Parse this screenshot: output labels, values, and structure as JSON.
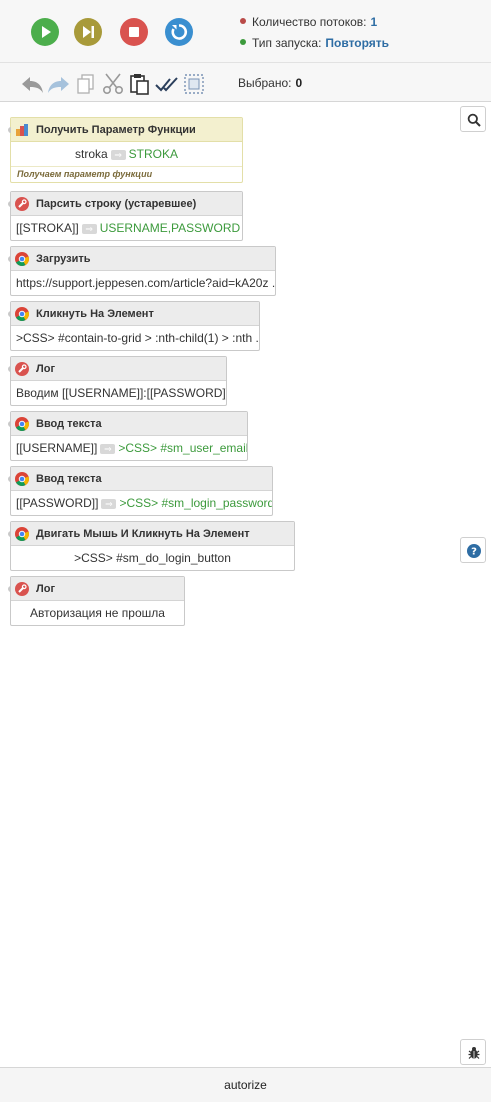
{
  "header": {
    "threads_label": "Количество потоков:",
    "threads_value": "1",
    "launch_label": "Тип запуска:",
    "launch_value": "Повторять",
    "selected_label": "Выбрано:",
    "selected_value": "0",
    "colors": {
      "play": "#4cae4c",
      "step": "#a89a3a",
      "stop": "#d9534f",
      "reset": "#3a8fd0",
      "dot_red": "#b94a48",
      "dot_green": "#3c9a3c"
    }
  },
  "blocks": [
    {
      "title": "Получить Параметр Функции",
      "icon": "function-param-icon",
      "param": "stroka",
      "target": "STROKA",
      "note": "Получаем параметр функции"
    },
    {
      "title": "Парсить строку (устаревшее)",
      "icon": "wrench-icon",
      "param": "[[STROKA]]",
      "target": "USERNAME,PASSWORD"
    },
    {
      "title": "Загрузить",
      "icon": "chrome-icon",
      "text": "https://support.jeppesen.com/article?aid=kA20z ..."
    },
    {
      "title": "Кликнуть На Элемент",
      "icon": "chrome-icon",
      "text": ">CSS> #contain-to-grid > :nth-child(1) > :nth ..."
    },
    {
      "title": "Лог",
      "icon": "wrench-icon",
      "text": "Вводим [[USERNAME]]:[[PASSWORD]]"
    },
    {
      "title": "Ввод текста",
      "icon": "chrome-icon",
      "param": "[[USERNAME]]",
      "target": ">CSS> #sm_user_email"
    },
    {
      "title": "Ввод текста",
      "icon": "chrome-icon",
      "param": "[[PASSWORD]]",
      "target": ">CSS> #sm_login_password"
    },
    {
      "title": "Двигать Мышь И Кликнуть На Элемент",
      "icon": "chrome-icon",
      "text": ">CSS> #sm_do_login_button"
    },
    {
      "title": "Лог",
      "icon": "wrench-icon",
      "text": "Авторизация не прошла"
    }
  ],
  "arrow_glyph": "⇒",
  "footer": {
    "project_name": "autorize"
  }
}
